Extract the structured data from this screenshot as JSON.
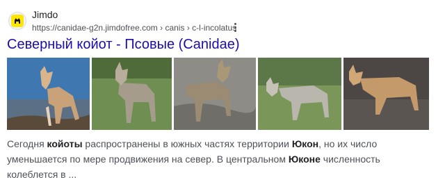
{
  "source": {
    "site_name": "Jimdo",
    "url": "https://canidae-g2n.jimdofree.com",
    "breadcrumbs": [
      "canis",
      "c-l-incolatus"
    ],
    "separator": "›"
  },
  "result": {
    "title": "Северный койот - Псовые (Canidae)"
  },
  "images": [
    {
      "name": "coyote-image-1",
      "subject": "coyote standing on rock, blue sky"
    },
    {
      "name": "coyote-image-2",
      "subject": "coyote in green grass"
    },
    {
      "name": "coyote-image-3",
      "subject": "coyote on rocky ground"
    },
    {
      "name": "coyote-image-4",
      "subject": "coyote walking in grass"
    },
    {
      "name": "coyote-image-5",
      "subject": "coyote walking on dark ground"
    }
  ],
  "snippet": {
    "parts": [
      {
        "text": "Сегодня ",
        "bold": false
      },
      {
        "text": "койоты",
        "bold": true
      },
      {
        "text": " распространены в южных частях территории ",
        "bold": false
      },
      {
        "text": "Юкон",
        "bold": true
      },
      {
        "text": ", но их число уменьшается по мере продвижения на север. В центральном ",
        "bold": false
      },
      {
        "text": "Юконе",
        "bold": true
      },
      {
        "text": " численность колеблется в ...",
        "bold": false
      }
    ]
  },
  "colors": {
    "title_link": "#1a0dab",
    "favicon_bg": "#ffe600",
    "snippet_text": "#4d5156",
    "bold_text": "#202124"
  },
  "icons": {
    "favicon": "jimdo-logo-icon",
    "more": "more-vert-icon"
  }
}
